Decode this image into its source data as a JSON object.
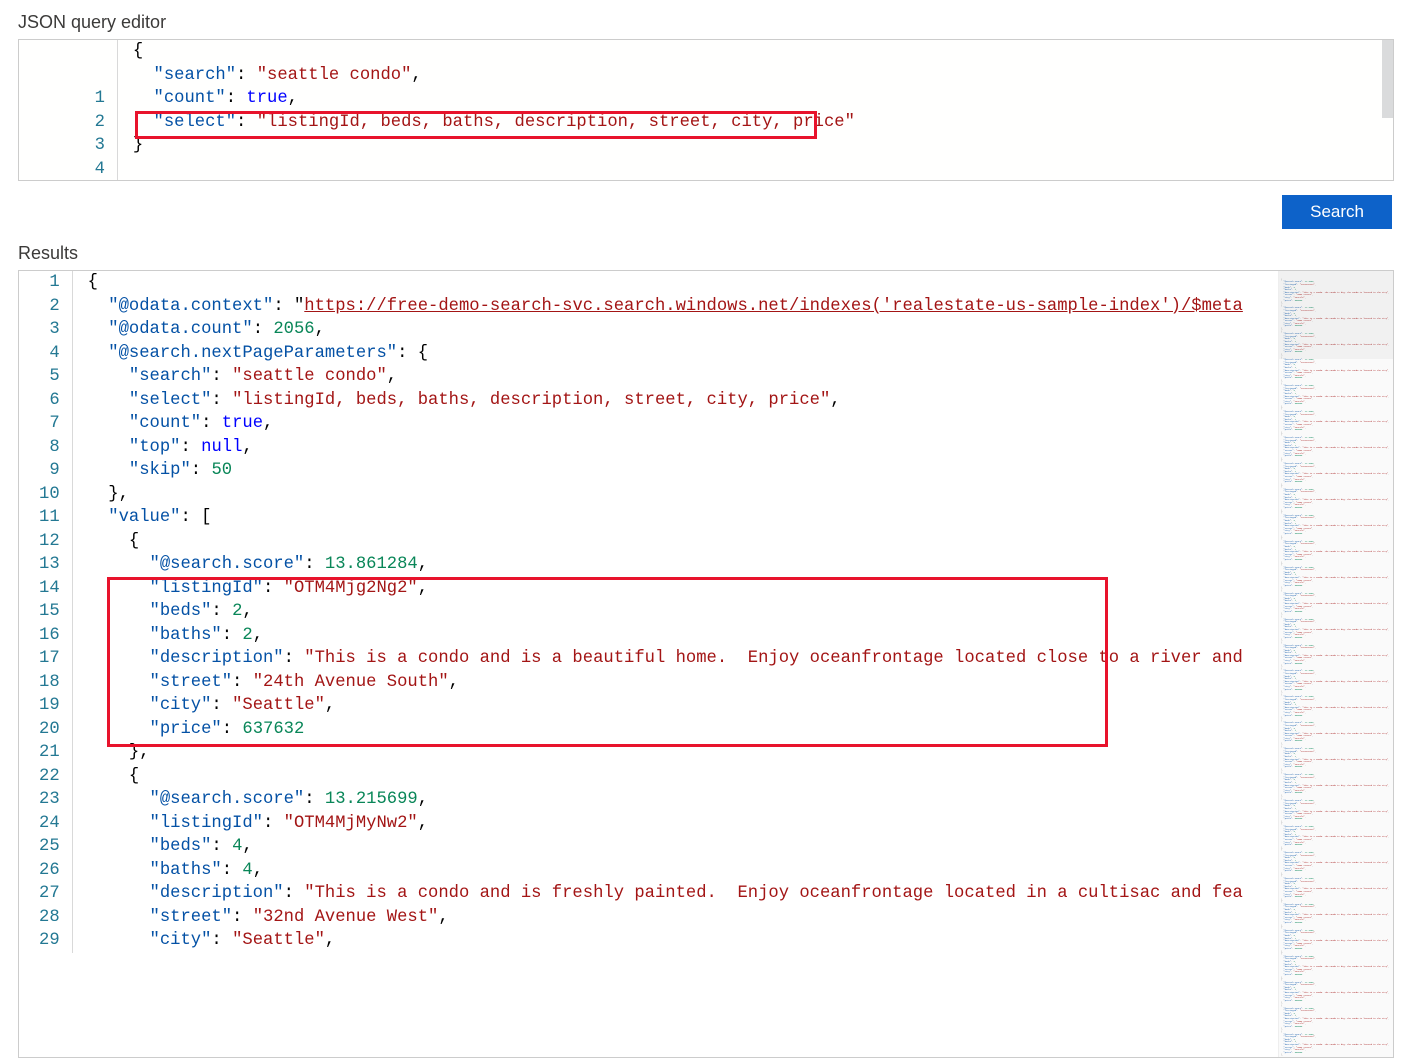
{
  "labels": {
    "query_editor": "JSON query editor",
    "results": "Results",
    "search_button": "Search"
  },
  "query": {
    "search": "seattle condo",
    "count": true,
    "select": "listingId, beds, baths, description, street, city, price"
  },
  "results": {
    "@odata.context": "https://free-demo-search-svc.search.windows.net/indexes('realestate-us-sample-index')/$meta",
    "@odata.count": 2056,
    "@search.nextPageParameters": {
      "search": "seattle condo",
      "select": "listingId, beds, baths, description, street, city, price",
      "count": true,
      "top": null,
      "skip": 50
    },
    "value": [
      {
        "@search.score": 13.861284,
        "listingId": "OTM4Mjg2Ng2",
        "beds": 2,
        "baths": 2,
        "description": "This is a condo and is a beautiful home.  Enjoy oceanfrontage located close to a river and",
        "street": "24th Avenue South",
        "city": "Seattle",
        "price": 637632
      },
      {
        "@search.score": 13.215699,
        "listingId": "OTM4MjMyNw2",
        "beds": 4,
        "baths": 4,
        "description": "This is a condo and is freshly painted.  Enjoy oceanfrontage located in a cultisac and fea",
        "street": "32nd Avenue West",
        "city": "Seattle"
      }
    ]
  }
}
